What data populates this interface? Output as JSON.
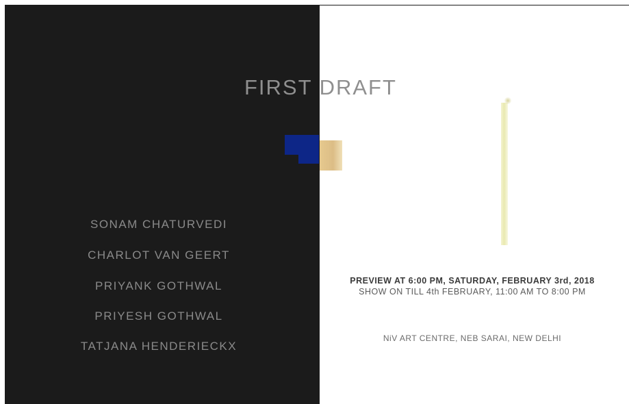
{
  "poster": {
    "title": "FIRST DRAFT",
    "artists": [
      "SONAM CHATURVEDI",
      "CHARLOT VAN GEERT",
      "PRIYANK GOTHWAL",
      "PRIYESH GOTHWAL",
      "TATJANA HENDERIECKX"
    ],
    "preview": "PREVIEW AT 6:00 PM, SATURDAY, FEBRUARY 3rd, 2018",
    "show_dates": "SHOW ON TILL 4th FEBRUARY, 11:00 AM TO 8:00 PM",
    "venue": "NiV ART CENTRE, NEB SARAI, NEW DELHI"
  },
  "colors": {
    "left_panel": "#1b1b1b",
    "right_panel": "#ffffff",
    "title_text": "#8f8f8f",
    "artist_text": "#8a8a8a",
    "blue_accent": "#0d2687",
    "gold_accent": "#dcbd86",
    "stick_yellow": "#e9e9b0"
  }
}
